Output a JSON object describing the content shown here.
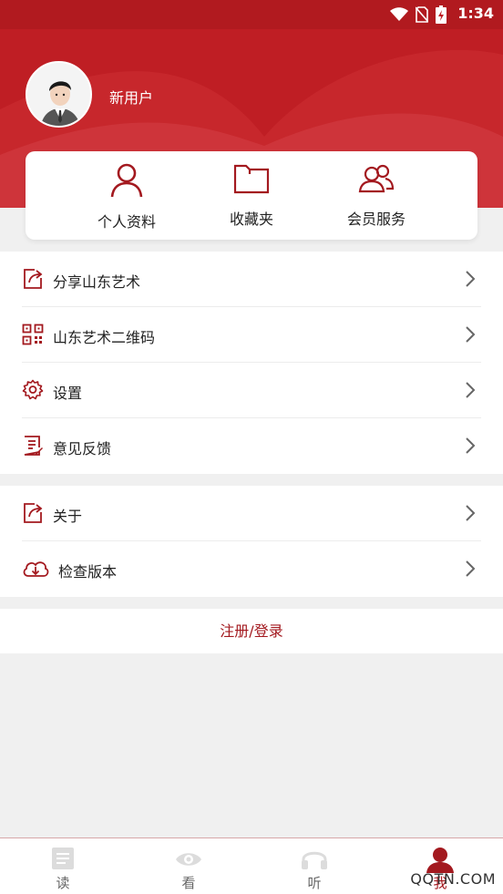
{
  "status_bar": {
    "time": "1:34",
    "icons": [
      "wifi-icon",
      "no-sim-icon",
      "battery-charging-icon"
    ]
  },
  "profile": {
    "username": "新用户",
    "avatar_icon": "user-avatar-icon"
  },
  "quick_actions": [
    {
      "label": "个人资料",
      "icon": "person-icon"
    },
    {
      "label": "收藏夹",
      "icon": "folder-icon"
    },
    {
      "label": "会员服务",
      "icon": "members-icon"
    }
  ],
  "menu_group_1": [
    {
      "label": "分享山东艺术",
      "icon": "share-icon"
    },
    {
      "label": "山东艺术二维码",
      "icon": "qrcode-icon"
    },
    {
      "label": "设置",
      "icon": "settings-gear-icon"
    },
    {
      "label": "意见反馈",
      "icon": "feedback-icon"
    }
  ],
  "menu_group_2": [
    {
      "label": "关于",
      "icon": "about-icon"
    },
    {
      "label": "检查版本",
      "icon": "cloud-download-icon"
    }
  ],
  "login_label": "注册/登录",
  "tabs": [
    {
      "label": "读",
      "icon": "read-icon",
      "active": false
    },
    {
      "label": "看",
      "icon": "eye-icon",
      "active": false
    },
    {
      "label": "听",
      "icon": "headphones-icon",
      "active": false
    },
    {
      "label": "我",
      "icon": "me-icon",
      "active": true
    }
  ],
  "watermark": "QQTN.COM",
  "colors": {
    "brand_red": "#bf1e24",
    "accent_red": "#a3191f",
    "background": "#f0f0f0"
  }
}
